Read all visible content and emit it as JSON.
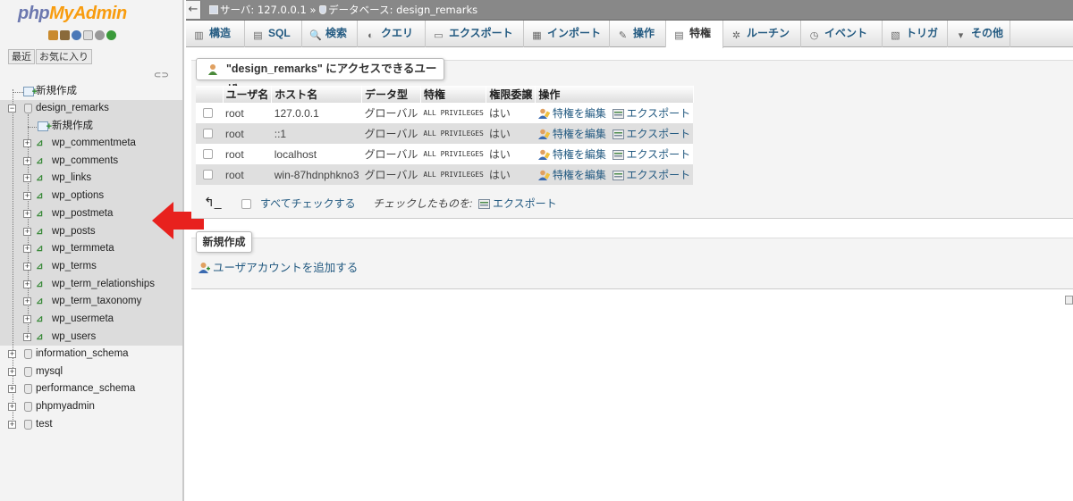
{
  "nav": {
    "logo_part1": "php",
    "logo_part2": "MyAdmin",
    "tab_recent": "最近",
    "tab_favorites": "お気に入り",
    "tree": {
      "root_new": "新規作成",
      "current_db": "design_remarks",
      "db_new": "新規作成",
      "tables": [
        "wp_commentmeta",
        "wp_comments",
        "wp_links",
        "wp_options",
        "wp_postmeta",
        "wp_posts",
        "wp_termmeta",
        "wp_terms",
        "wp_term_relationships",
        "wp_term_taxonomy",
        "wp_usermeta",
        "wp_users"
      ],
      "other_dbs": [
        "information_schema",
        "mysql",
        "performance_schema",
        "phpmyadmin",
        "test"
      ]
    }
  },
  "topbar": {
    "server": "サーバ: 127.0.0.1",
    "separator": "»",
    "database": "データベース: design_remarks"
  },
  "tabs": [
    "構造",
    "SQL",
    "検索",
    "クエリ",
    "エクスポート",
    "インポート",
    "操作",
    "特権",
    "ルーチン",
    "イベント",
    "トリガ",
    "その他"
  ],
  "active_tab": "特権",
  "users_section": {
    "legend": "\"design_remarks\" にアクセスできるユーザ",
    "columns": [
      "ユーザ名",
      "ホスト名",
      "データ型",
      "特権",
      "権限委譲",
      "操作"
    ],
    "rows": [
      {
        "user": "root",
        "host": "127.0.0.1",
        "type": "グローバル",
        "privileges": "ALL PRIVILEGES",
        "grant": "はい",
        "edit": "特権を編集",
        "export": "エクスポート"
      },
      {
        "user": "root",
        "host": "::1",
        "type": "グローバル",
        "privileges": "ALL PRIVILEGES",
        "grant": "はい",
        "edit": "特権を編集",
        "export": "エクスポート"
      },
      {
        "user": "root",
        "host": "localhost",
        "type": "グローバル",
        "privileges": "ALL PRIVILEGES",
        "grant": "はい",
        "edit": "特権を編集",
        "export": "エクスポート"
      },
      {
        "user": "root",
        "host": "win-87hdnphkno3",
        "type": "グローバル",
        "privileges": "ALL PRIVILEGES",
        "grant": "はい",
        "edit": "特権を編集",
        "export": "エクスポート"
      }
    ],
    "check_all": "すべてチェックする",
    "with_selected": "チェックしたものを:",
    "bulk_export": "エクスポート"
  },
  "new_section": {
    "legend": "新規作成",
    "add_user": "ユーザアカウントを追加する"
  },
  "colors": {
    "link": "#235a81",
    "logo_blue": "#6c78af",
    "logo_orange": "#f89c0e",
    "arrow_red": "#e8211e"
  }
}
